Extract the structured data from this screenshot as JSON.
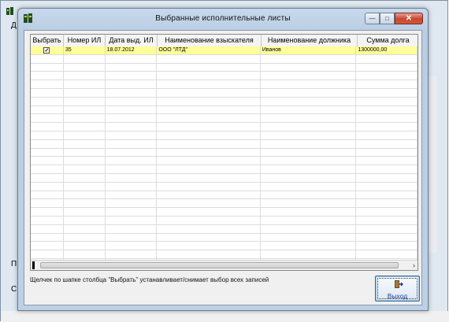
{
  "background": {
    "left_chars": [
      "Д",
      "П",
      "С"
    ]
  },
  "dialog": {
    "title": "Выбранные исполнительные листы",
    "window_buttons": {
      "minimize": "—",
      "maximize": "□",
      "close": "✕"
    }
  },
  "grid": {
    "columns": [
      "Выбрать",
      "Номер ИЛ",
      "Дата выд. ИЛ",
      "Наименование взыскателя",
      "Наименование должника",
      "Сумма долга"
    ],
    "rows": [
      {
        "checked": true,
        "number": "35",
        "date": "18.07.2012",
        "claimant": "ООО \"ЛТД\"",
        "debtor": "Иванов",
        "amount": "1300000,00"
      }
    ],
    "scroll_right_glyph": "›"
  },
  "hint_text": "Щелчек по шапке столбца \"Выбрать\" устанавливает/снимает выбор всех записей",
  "exit_button": {
    "label": "Выход"
  },
  "colors": {
    "selected_row": "#ffff99",
    "title_gradient": "#c8d9ec",
    "close_button": "#c7472f"
  }
}
